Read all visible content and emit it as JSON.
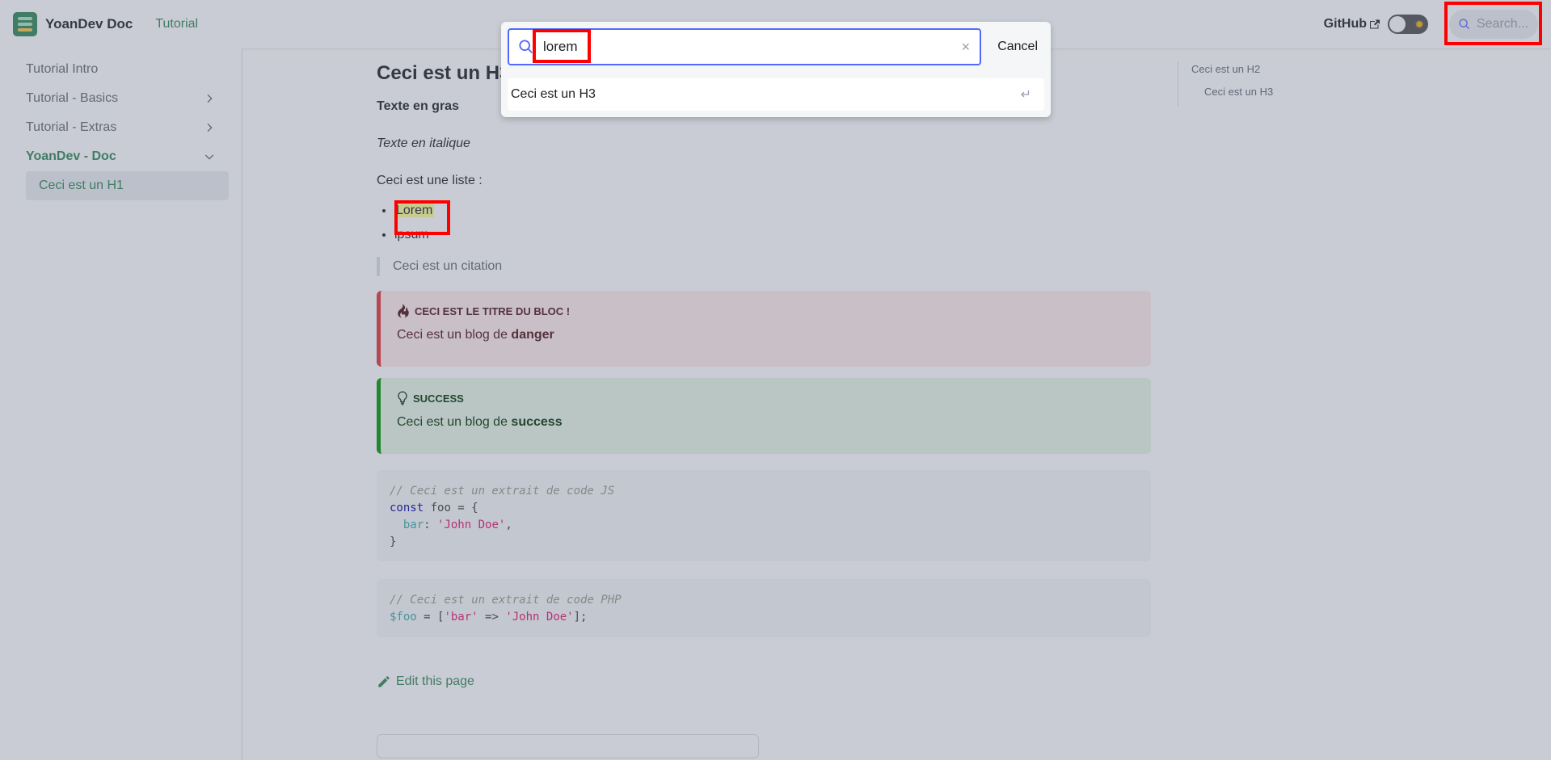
{
  "navbar": {
    "brand": "YoanDev Doc",
    "tutorial_link": "Tutorial",
    "github": "GitHub",
    "search_placeholder": "Search..."
  },
  "sidebar": {
    "items": [
      {
        "label": "Tutorial Intro"
      },
      {
        "label": "Tutorial - Basics"
      },
      {
        "label": "Tutorial - Extras"
      },
      {
        "label": "YoanDev - Doc"
      },
      {
        "label": "Ceci est un H1"
      }
    ]
  },
  "content": {
    "heading": "Ceci est un H3",
    "bold_text": "Texte en gras",
    "italic_text": "Texte en italique",
    "list_intro": "Ceci est une liste :",
    "list_items": [
      "Lorem",
      "ipsum"
    ],
    "quote": "Ceci est un citation",
    "danger": {
      "title": "Ceci est le titre du bloc !",
      "text": "Ceci est un blog de ",
      "strong": "danger"
    },
    "success": {
      "title": "success",
      "text": "Ceci est un blog de ",
      "strong": "success"
    },
    "code_js": {
      "comment": "// Ceci est un extrait de code JS",
      "kw": "const",
      "var": " foo = {",
      "prop": "  bar",
      "colon": ": ",
      "str": "'John Doe'",
      "comma": ",",
      "close": "}"
    },
    "code_php": {
      "comment": "// Ceci est un extrait de code PHP",
      "var": "$foo",
      "eq": " = [",
      "key": "'bar'",
      "arrow": " => ",
      "val": "'John Doe'",
      "end": "];"
    },
    "edit_link": "Edit this page"
  },
  "toc": {
    "items": [
      {
        "label": "Ceci est un H2"
      },
      {
        "label": "Ceci est un H3"
      }
    ]
  },
  "search_modal": {
    "query": "lorem",
    "cancel_label": "Cancel",
    "hit_label": "Ceci est un H3",
    "enter_symbol": "↵",
    "clear_symbol": "×"
  },
  "colors": {
    "primary": "#2e8555",
    "search_focus": "#5468ff",
    "highlight_box": "#ff0000"
  }
}
